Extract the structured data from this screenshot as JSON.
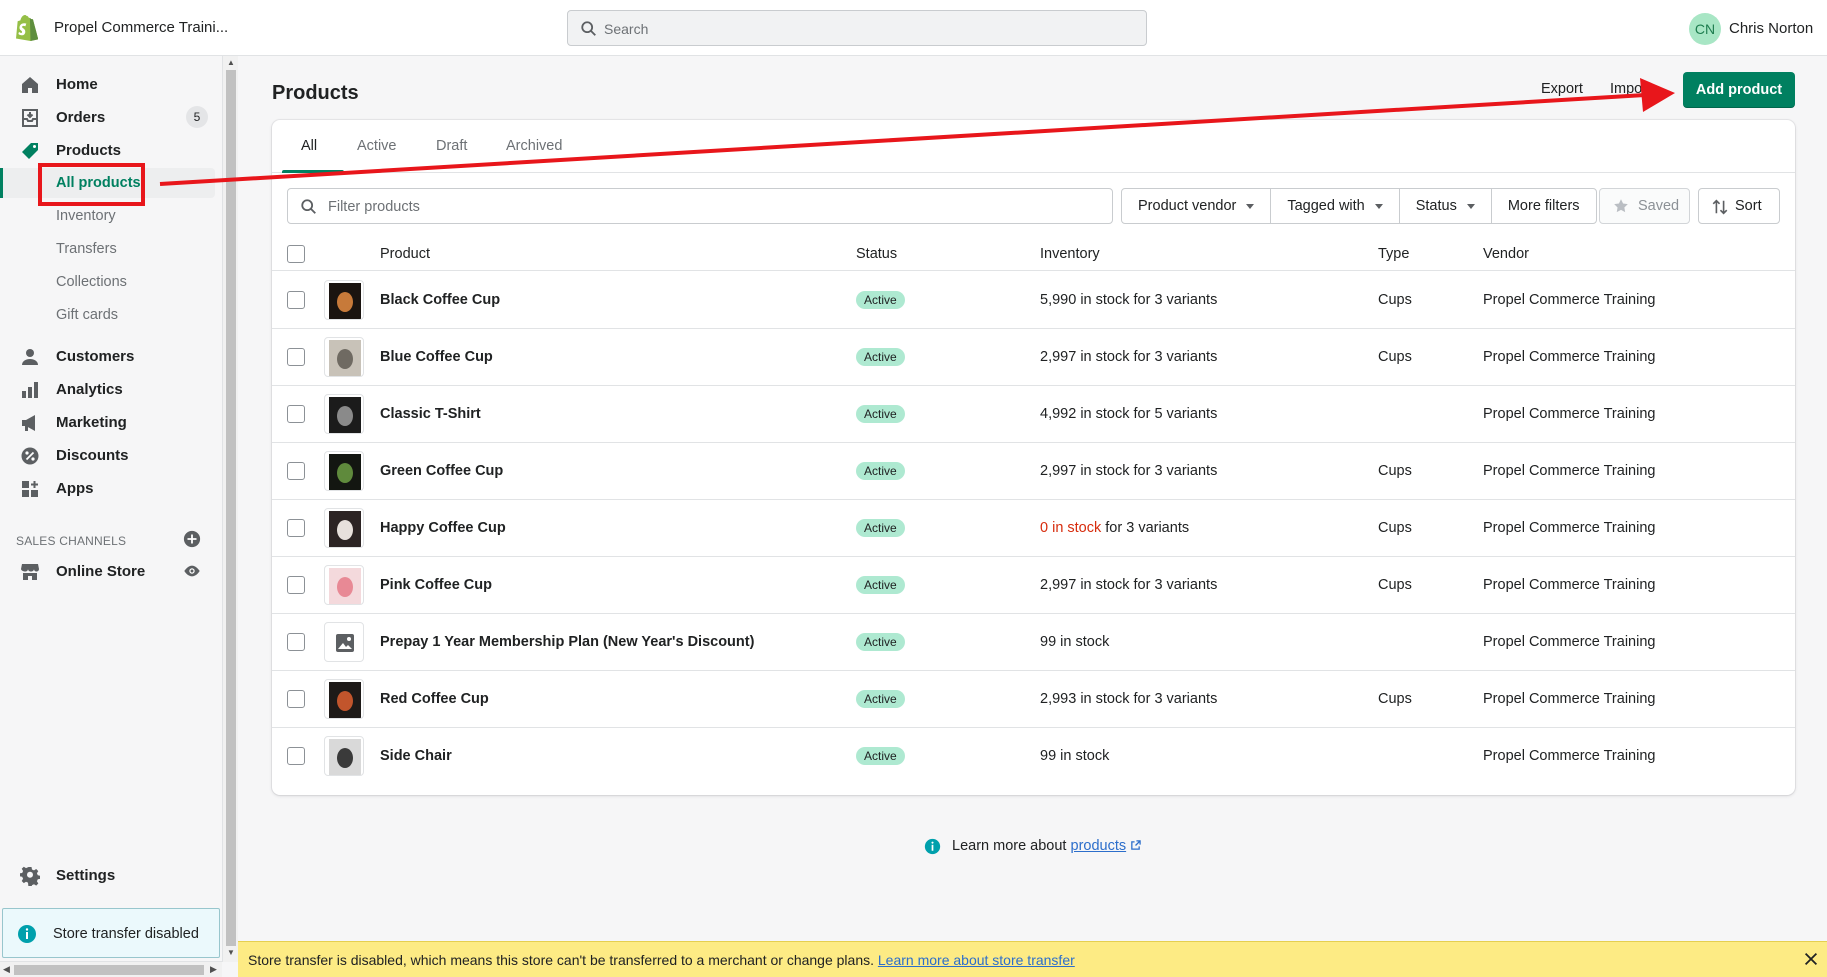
{
  "topbar": {
    "store_name": "Propel Commerce Traini...",
    "search_placeholder": "Search",
    "user_initials": "CN",
    "user_name": "Chris Norton"
  },
  "sidebar": {
    "items": [
      {
        "label": "Home",
        "icon": "home-icon"
      },
      {
        "label": "Orders",
        "icon": "orders-icon",
        "badge": "5"
      },
      {
        "label": "Products",
        "icon": "tag-icon"
      },
      {
        "label": "All products"
      },
      {
        "label": "Inventory"
      },
      {
        "label": "Transfers"
      },
      {
        "label": "Collections"
      },
      {
        "label": "Gift cards"
      },
      {
        "label": "Customers",
        "icon": "person-icon"
      },
      {
        "label": "Analytics",
        "icon": "bar-chart-icon"
      },
      {
        "label": "Marketing",
        "icon": "megaphone-icon"
      },
      {
        "label": "Discounts",
        "icon": "discount-icon"
      },
      {
        "label": "Apps",
        "icon": "apps-icon"
      }
    ],
    "sales_channels_header": "SALES CHANNELS",
    "online_store": "Online Store",
    "settings": "Settings",
    "transfer_notice": "Store transfer disabled"
  },
  "main": {
    "title": "Products",
    "export_label": "Export",
    "import_label": "Import",
    "add_product_label": "Add product",
    "tabs": [
      "All",
      "Active",
      "Draft",
      "Archived"
    ],
    "filter_placeholder": "Filter products",
    "filters": [
      "Product vendor",
      "Tagged with",
      "Status",
      "More filters"
    ],
    "saved_label": "Saved",
    "sort_label": "Sort",
    "columns": [
      "Product",
      "Status",
      "Inventory",
      "Type",
      "Vendor"
    ],
    "rows": [
      {
        "name": "Black Coffee Cup",
        "status": "Active",
        "inventory": "5,990 in stock for 3 variants",
        "inv_out": "",
        "type": "Cups",
        "vendor": "Propel Commerce Training"
      },
      {
        "name": "Blue Coffee Cup",
        "status": "Active",
        "inventory": "2,997 in stock for 3 variants",
        "inv_out": "",
        "type": "Cups",
        "vendor": "Propel Commerce Training"
      },
      {
        "name": "Classic T-Shirt",
        "status": "Active",
        "inventory": "4,992 in stock for 5 variants",
        "inv_out": "",
        "type": "",
        "vendor": "Propel Commerce Training"
      },
      {
        "name": "Green Coffee Cup",
        "status": "Active",
        "inventory": "2,997 in stock for 3 variants",
        "inv_out": "",
        "type": "Cups",
        "vendor": "Propel Commerce Training"
      },
      {
        "name": "Happy Coffee Cup",
        "status": "Active",
        "inventory": " for 3 variants",
        "inv_out": "0 in stock",
        "type": "Cups",
        "vendor": "Propel Commerce Training"
      },
      {
        "name": "Pink Coffee Cup",
        "status": "Active",
        "inventory": "2,997 in stock for 3 variants",
        "inv_out": "",
        "type": "Cups",
        "vendor": "Propel Commerce Training"
      },
      {
        "name": "Prepay 1 Year Membership Plan (New Year's Discount)",
        "status": "Active",
        "inventory": "99 in stock",
        "inv_out": "",
        "type": "",
        "vendor": "Propel Commerce Training"
      },
      {
        "name": "Red Coffee Cup",
        "status": "Active",
        "inventory": "2,993 in stock for 3 variants",
        "inv_out": "",
        "type": "Cups",
        "vendor": "Propel Commerce Training"
      },
      {
        "name": "Side Chair",
        "status": "Active",
        "inventory": "99 in stock",
        "inv_out": "",
        "type": "",
        "vendor": "Propel Commerce Training"
      }
    ],
    "learn_prefix": "Learn more about ",
    "learn_link": "products"
  },
  "banner": {
    "text": "Store transfer is disabled, which means this store can't be transferred to a merchant or change plans. ",
    "link": "Learn more about store transfer"
  },
  "colors": {
    "accent": "#008060",
    "active_badge": "#aee9d1",
    "annotation": "#e8161b",
    "out_of_stock": "#d72c0d",
    "banner": "#fdeb84"
  }
}
